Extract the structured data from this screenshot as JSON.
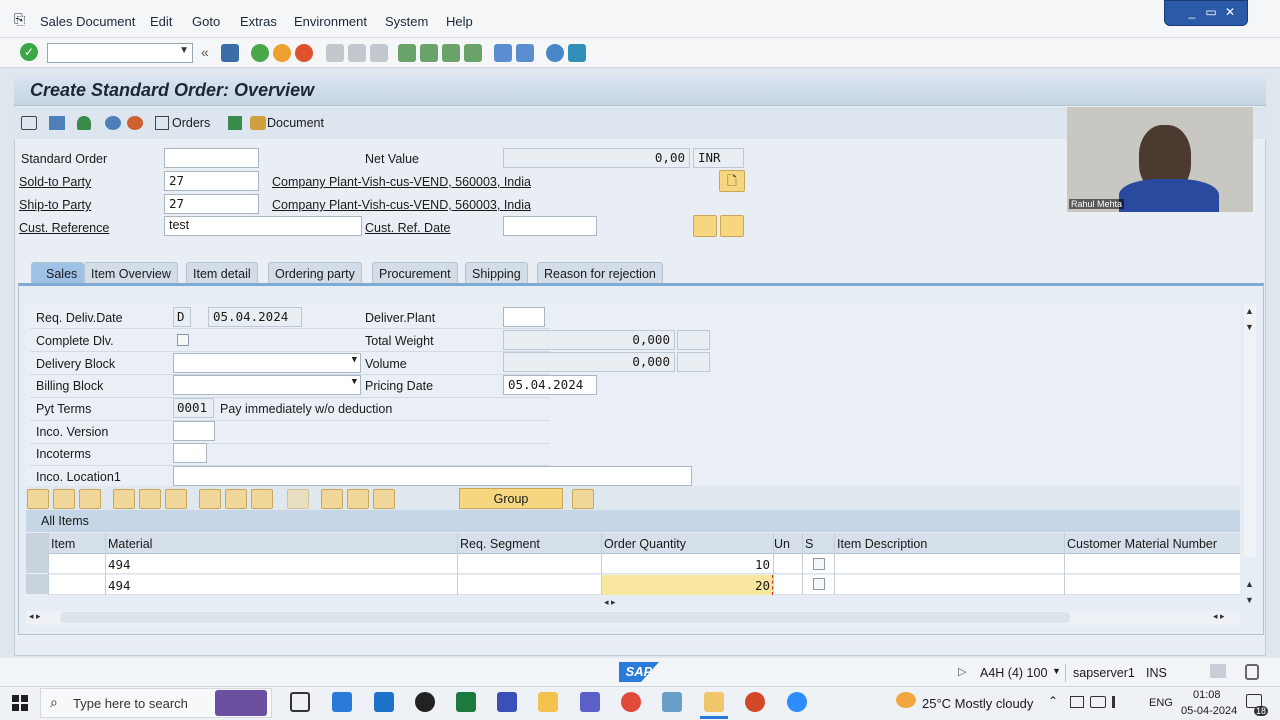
{
  "menu": [
    "Sales Document",
    "Edit",
    "Goto",
    "Extras",
    "Environment",
    "System",
    "Help"
  ],
  "window_controls": [
    "_",
    "▭",
    "✕"
  ],
  "title": "Create Standard Order: Overview",
  "app_toolbar": {
    "orders_label": "Orders",
    "document_label": "Document"
  },
  "header": {
    "standard_order_label": "Standard Order",
    "standard_order_value": "",
    "sold_to_label": "Sold-to Party",
    "sold_to_value": "27",
    "sold_to_desc": "Company Plant-Vish-cus-VEND, 560003, India",
    "ship_to_label": "Ship-to Party",
    "ship_to_value": "27",
    "ship_to_desc": "Company Plant-Vish-cus-VEND, 560003, India",
    "cust_ref_label": "Cust. Reference",
    "cust_ref_value": "test",
    "cust_ref_date_label": "Cust. Ref. Date",
    "cust_ref_date_value": "",
    "net_value_label": "Net Value",
    "net_value": "0,00",
    "currency": "INR"
  },
  "tabs": [
    "Sales",
    "Item Overview",
    "Item detail",
    "Ordering party",
    "Procurement",
    "Shipping",
    "Reason for rejection"
  ],
  "sales_tab": {
    "req_deliv_date_label": "Req. Deliv.Date",
    "req_deliv_date_type": "D",
    "req_deliv_date": "05.04.2024",
    "complete_dlv_label": "Complete Dlv.",
    "delivery_block_label": "Delivery Block",
    "billing_block_label": "Billing Block",
    "pyt_terms_label": "Pyt Terms",
    "pyt_terms_value": "0001",
    "pyt_terms_desc": "Pay immediately w/o deduction",
    "inco_version_label": "Inco. Version",
    "incoterms_label": "Incoterms",
    "inco_location_label": "Inco. Location1",
    "deliver_plant_label": "Deliver.Plant",
    "total_weight_label": "Total Weight",
    "total_weight": "0,000",
    "volume_label": "Volume",
    "volume": "0,000",
    "pricing_date_label": "Pricing Date",
    "pricing_date": "05.04.2024"
  },
  "table": {
    "group_label": "Group",
    "all_items_label": "All Items",
    "columns": [
      "Item",
      "Material",
      "Req. Segment",
      "Order Quantity",
      "Un",
      "S",
      "Item Description",
      "Customer Material Number"
    ],
    "rows": [
      {
        "item": "",
        "material": "494",
        "segment": "",
        "qty": "10",
        "un": ""
      },
      {
        "item": "",
        "material": "494",
        "segment": "",
        "qty": "20",
        "un": ""
      }
    ]
  },
  "video": {
    "name": "Rahul Mehta"
  },
  "status": {
    "system": "A4H (4) 100",
    "server": "sapserver1",
    "mode": "INS",
    "logo": "SAP"
  },
  "taskbar": {
    "search_placeholder": "Type here to search",
    "weather": "25°C  Mostly cloudy",
    "lang": "ENG",
    "time": "01:08",
    "date": "05-04-2024",
    "notif_count": "18"
  },
  "colors": {
    "accent_tab": "#9ec2e6",
    "highlight": "#f9e79f",
    "sap_blue": "#2a7bd8"
  }
}
